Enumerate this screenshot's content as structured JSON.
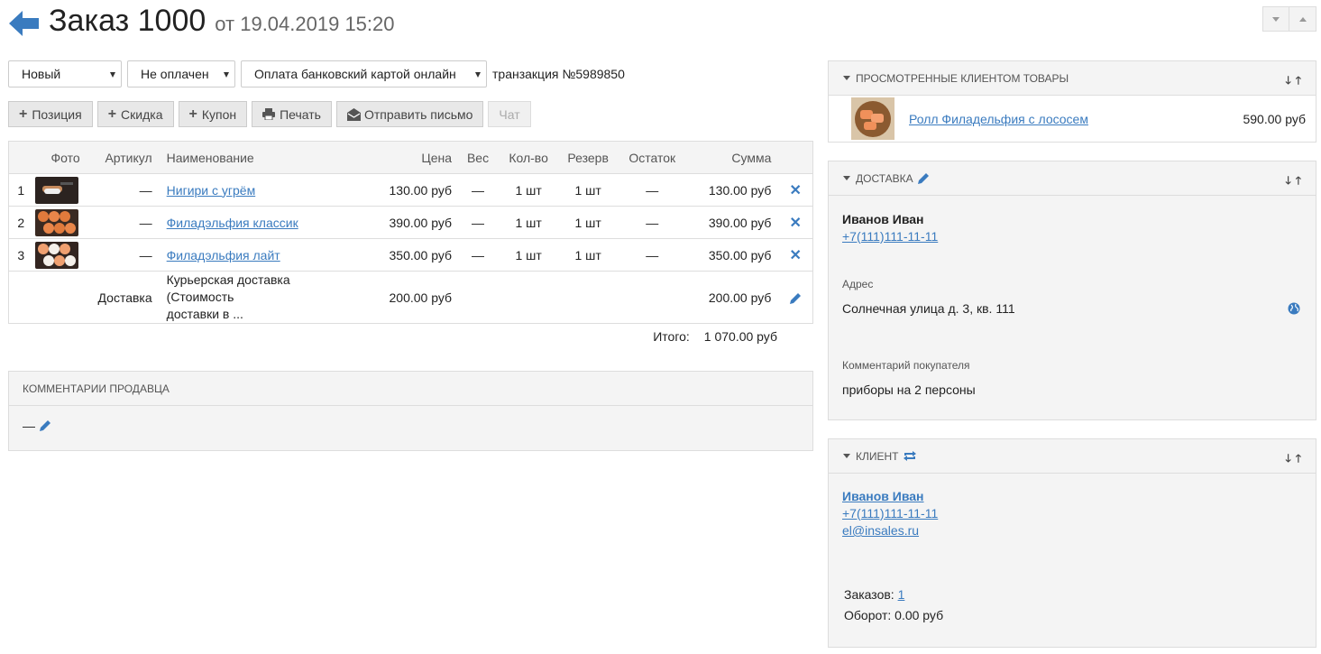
{
  "header": {
    "title": "Заказ 1000",
    "date": "от 19.04.2019 15:20"
  },
  "status_select": "Новый",
  "payment_status_select": "Не оплачен",
  "payment_method_select": "Оплата банковский картой онлайн",
  "transaction": "транзакция №5989850",
  "actions": {
    "position": "Позиция",
    "discount": "Скидка",
    "coupon": "Купон",
    "print": "Печать",
    "send_letter": "Отправить письмо",
    "chat": "Чат"
  },
  "table": {
    "columns": [
      "Фото",
      "Артикул",
      "Наименование",
      "Цена",
      "Вес",
      "Кол-во",
      "Резерв",
      "Остаток",
      "Сумма"
    ],
    "rows": [
      {
        "num": "1",
        "article": "—",
        "name": "Нигири с угрём",
        "price": "130.00 руб",
        "weight": "—",
        "qty": "1 шт",
        "reserve": "1 шт",
        "stock": "—",
        "sum": "130.00 руб"
      },
      {
        "num": "2",
        "article": "—",
        "name": "Филадэльфия классик",
        "price": "390.00 руб",
        "weight": "—",
        "qty": "1 шт",
        "reserve": "1 шт",
        "stock": "—",
        "sum": "390.00 руб"
      },
      {
        "num": "3",
        "article": "—",
        "name": "Филадэльфия лайт",
        "price": "350.00 руб",
        "weight": "—",
        "qty": "1 шт",
        "reserve": "1 шт",
        "stock": "—",
        "sum": "350.00 руб"
      }
    ],
    "delivery": {
      "label": "Доставка",
      "name_line1": "Курьерская доставка (Стоимость",
      "name_line2": "доставки в ...",
      "price": "200.00 руб",
      "sum": "200.00 руб"
    },
    "total_label": "Итого:",
    "total_value": "1 070.00 руб"
  },
  "seller_comments": {
    "title": "Комментарии продавца",
    "value": "—"
  },
  "viewed": {
    "title": "Просмотренные клиентом товары",
    "item_name": "Ролл Филадельфия с лососем",
    "item_price": "590.00 руб"
  },
  "delivery_panel": {
    "title": "Доставка",
    "name": "Иванов Иван",
    "phone": "+7(111)111-11-11",
    "address_label": "Адрес",
    "address": "Солнечная улица д. 3, кв. 111",
    "comment_label": "Комментарий покупателя",
    "comment": "приборы на 2 персоны"
  },
  "client_panel": {
    "title": "Клиент",
    "name": "Иванов Иван",
    "phone": "+7(111)111-11-11",
    "email": "el@insales.ru",
    "orders_label": "Заказов:",
    "orders_value": "1",
    "turnover_label": "Оборот:",
    "turnover_value": "0.00 руб"
  },
  "colors": {
    "accent": "#3a7bbf",
    "panel_bg": "#f4f4f4",
    "border": "#dddddd"
  },
  "icons": {
    "back": "arrow-left-icon",
    "plus": "plus-icon",
    "print": "printer-icon",
    "mail": "envelope-icon",
    "delete": "close-icon",
    "edit": "pencil-icon",
    "map": "globe-icon",
    "refresh": "refresh-icon"
  }
}
